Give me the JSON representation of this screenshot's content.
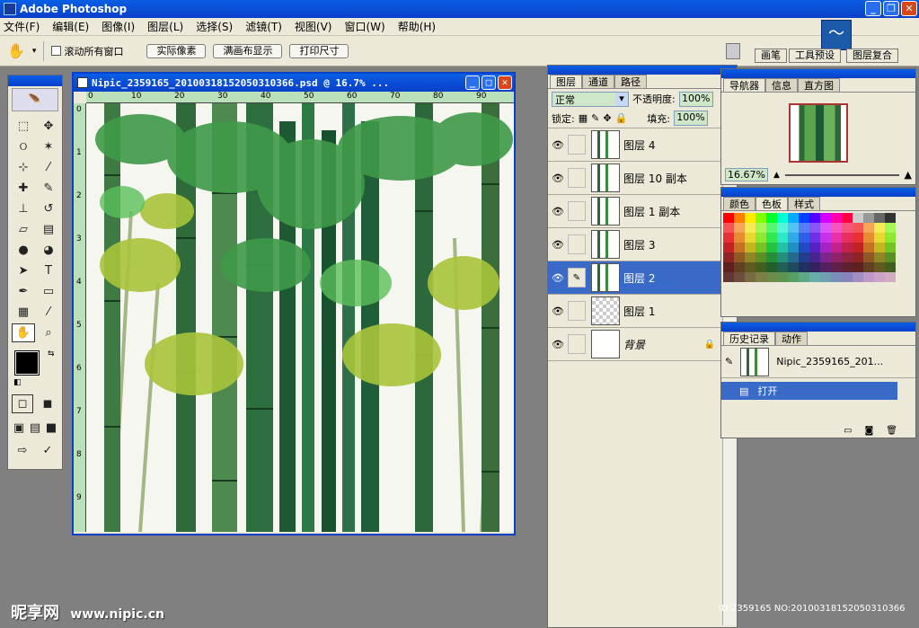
{
  "app": {
    "title": "Adobe Photoshop"
  },
  "menu": [
    "文件(F)",
    "编辑(E)",
    "图像(I)",
    "图层(L)",
    "选择(S)",
    "滤镜(T)",
    "视图(V)",
    "窗口(W)",
    "帮助(H)"
  ],
  "options": {
    "scroll_all": "滚动所有窗口",
    "actual_pixels": "实际像素",
    "fit_screen": "满画布显示",
    "print_size": "打印尺寸"
  },
  "well_tabs": [
    "画笔",
    "工具预设",
    "图层复合"
  ],
  "document": {
    "title": "Nipic_2359165_20100318152050310366.psd @ 16.7% ...",
    "ruler_h": [
      "0",
      "10",
      "20",
      "30",
      "40",
      "50",
      "60",
      "70",
      "80",
      "90"
    ],
    "ruler_v": [
      "0",
      "1",
      "2",
      "3",
      "4",
      "5",
      "6",
      "7",
      "8",
      "9"
    ]
  },
  "layers_panel": {
    "tabs": [
      "图层",
      "通道",
      "路径"
    ],
    "blend_mode": "正常",
    "opacity_label": "不透明度:",
    "opacity": "100%",
    "lock_label": "锁定:",
    "fill_label": "填充:",
    "fill": "100%",
    "layers": [
      {
        "name": "图层 4",
        "thumb": "bamboo",
        "selected": false
      },
      {
        "name": "图层 10 副本",
        "thumb": "bamboo",
        "selected": false
      },
      {
        "name": "图层 1 副本",
        "thumb": "bamboo",
        "selected": false
      },
      {
        "name": "图层 3",
        "thumb": "bamboo",
        "selected": false
      },
      {
        "name": "图层 2",
        "thumb": "bamboo",
        "selected": true
      },
      {
        "name": "图层 1",
        "thumb": "empty",
        "selected": false
      },
      {
        "name": "背景",
        "thumb": "white",
        "selected": false
      }
    ]
  },
  "navigator_panel": {
    "tabs": [
      "导航器",
      "信息",
      "直方图"
    ],
    "zoom": "16.67%"
  },
  "color_panel": {
    "tabs": [
      "颜色",
      "色板",
      "样式"
    ]
  },
  "history_panel": {
    "tabs": [
      "历史记录",
      "动作"
    ],
    "snapshot": "Nipic_2359165_201...",
    "items": [
      "打开"
    ]
  },
  "watermark": {
    "logo": "昵享网",
    "url": "www.nipic.cn"
  },
  "image_id": "ID:2359165 NO:20100318152050310366"
}
